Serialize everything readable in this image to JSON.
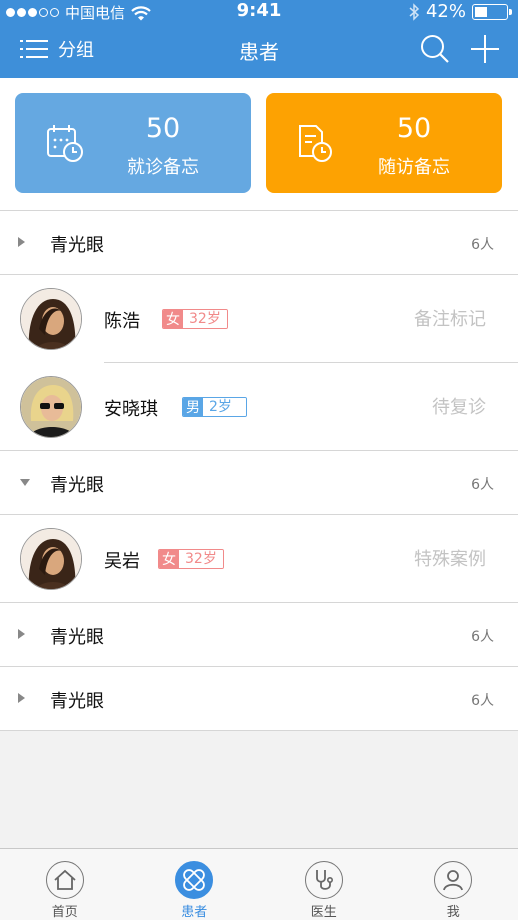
{
  "status_bar": {
    "carrier": "中国电信",
    "time": "9:41",
    "battery": "42%",
    "battery_level": 0.42,
    "wifi_icon": "wifi-icon",
    "bluetooth_icon": "bluetooth-icon"
  },
  "nav": {
    "left_label": "分组",
    "title": "患者",
    "menu_icon": "menu-icon",
    "search_icon": "search-icon",
    "add_icon": "plus-icon",
    "bg_color": "#3e8fd9"
  },
  "cards": [
    {
      "count": "50",
      "label": "就诊备忘",
      "color": "#65a8e1",
      "icon": "calendar-clock-icon"
    },
    {
      "count": "50",
      "label": "随访备忘",
      "color": "#fda202",
      "icon": "document-clock-icon"
    }
  ],
  "groups": [
    {
      "name": "青光眼",
      "count": "6人",
      "expanded": false,
      "patients": []
    },
    {
      "name": "青光眼",
      "count": "6人",
      "expanded": false,
      "patients": []
    },
    {
      "name": "青光眼",
      "count": "6人",
      "expanded": false,
      "patients": []
    },
    {
      "name": "青光眼",
      "count": "6人",
      "expanded": false,
      "patients": []
    }
  ],
  "patients": {
    "p1": {
      "name": "陈浩",
      "sex": "女",
      "age": "32岁",
      "note": "备注标记"
    },
    "p2": {
      "name": "安晓琪",
      "sex": "男",
      "age": "2岁",
      "note": "待复诊"
    },
    "p3": {
      "name": "吴岩",
      "sex": "女",
      "age": "32岁",
      "note": "特殊案例"
    }
  },
  "tabs": [
    {
      "label": "首页",
      "icon": "home-icon",
      "active": false
    },
    {
      "label": "患者",
      "icon": "bandage-icon",
      "active": true
    },
    {
      "label": "医生",
      "icon": "stethoscope-icon",
      "active": false
    },
    {
      "label": "我",
      "icon": "user-icon",
      "active": false
    }
  ]
}
